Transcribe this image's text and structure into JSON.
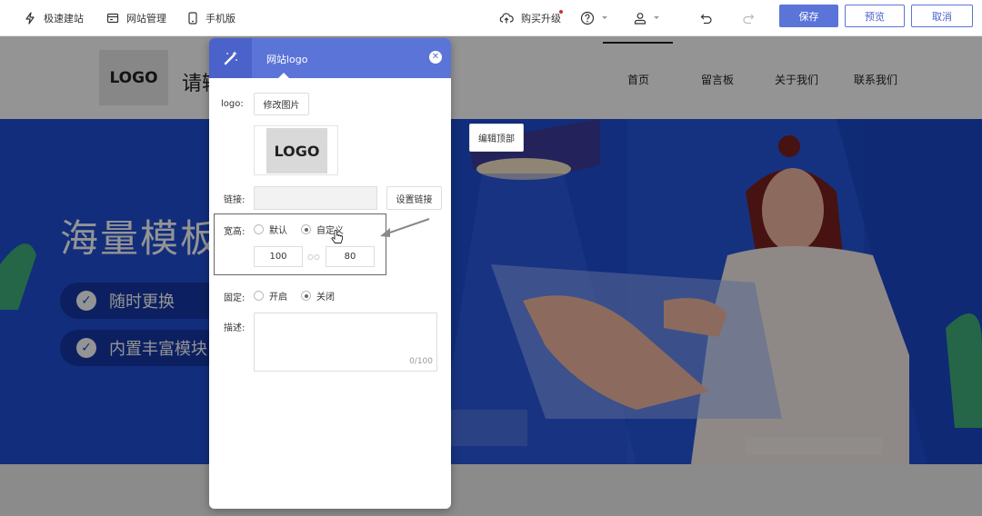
{
  "toolbar": {
    "quick_build": "极速建站",
    "site_manage": "网站管理",
    "mobile": "手机版",
    "upgrade": "购买升级",
    "save": "保存",
    "preview": "预览",
    "cancel": "取消",
    "accent": "#5b74d8"
  },
  "site": {
    "logo": "LOGO",
    "name": "请输",
    "nav": [
      "首页",
      "留言板",
      "关于我们",
      "联系我们"
    ],
    "hero_title": "海量模板",
    "features": [
      "随时更换",
      "内置丰富模块"
    ],
    "edit_top": "编辑顶部"
  },
  "panel": {
    "title": "网站logo",
    "logo_label": "logo:",
    "change_image": "修改图片",
    "preview_logo": "LOGO",
    "link_label": "链接:",
    "set_link": "设置链接",
    "size_label": "宽高:",
    "size_default": "默认",
    "size_custom": "自定义",
    "width": "100",
    "height": "80",
    "fixed_label": "固定:",
    "fixed_on": "开启",
    "fixed_off": "关闭",
    "desc_label": "描述:",
    "desc_counter": "0/100"
  }
}
